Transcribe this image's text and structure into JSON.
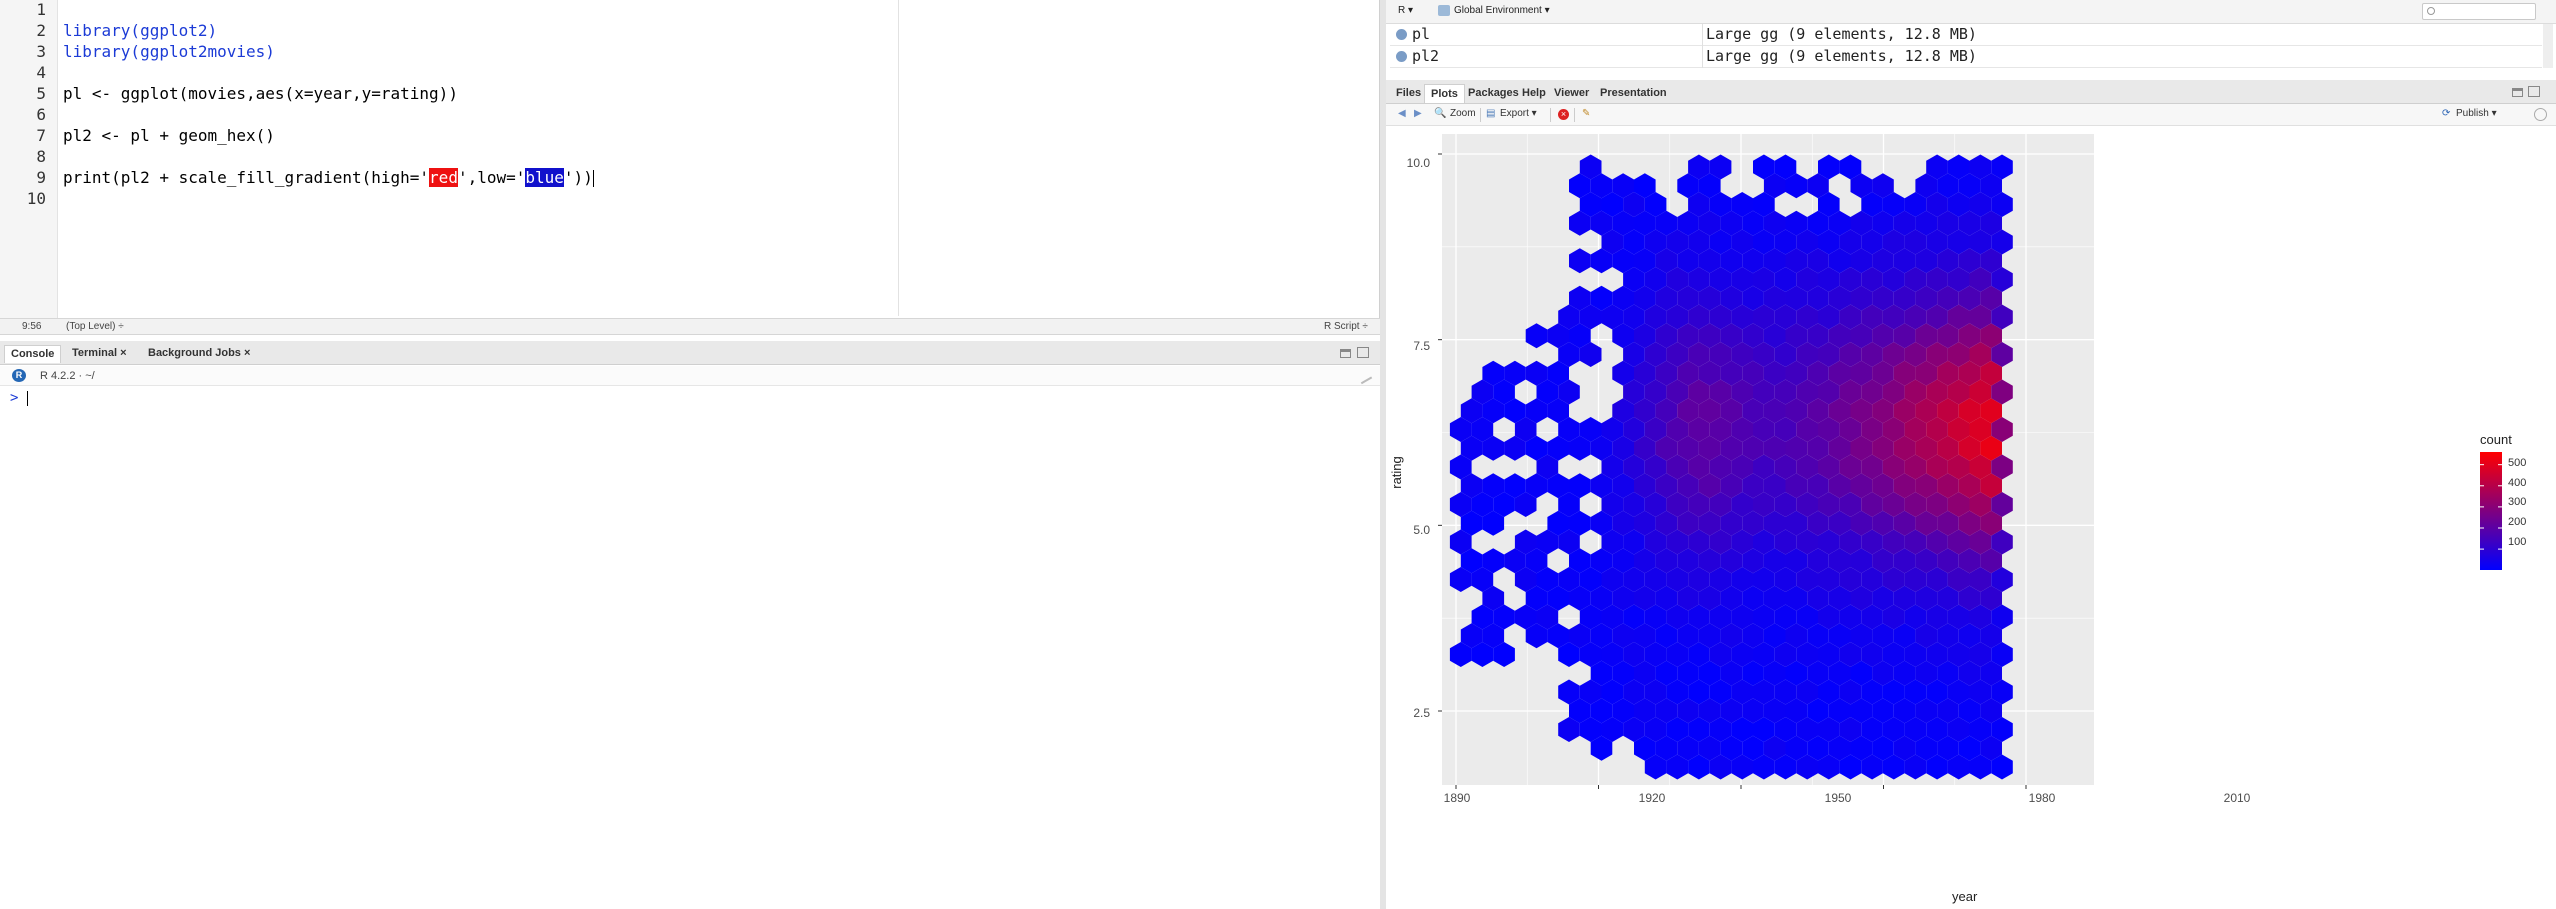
{
  "editor": {
    "lines": [
      {
        "num": "1",
        "html": ""
      },
      {
        "num": "2",
        "text_parts": [
          "library",
          "(ggplot2)"
        ]
      },
      {
        "num": "3",
        "text_parts": [
          "library",
          "(ggplot2movies)"
        ]
      },
      {
        "num": "4"
      },
      {
        "num": "5",
        "text": "pl <- ggplot(movies,aes(x=year,y=rating))"
      },
      {
        "num": "6"
      },
      {
        "num": "7",
        "text": "pl2 <- pl + geom_hex()"
      },
      {
        "num": "8"
      },
      {
        "num": "9"
      },
      {
        "num": "10"
      }
    ],
    "line2": "library(ggplot2)",
    "line3": "library(ggplot2movies)",
    "line5": "pl <- ggplot(movies,aes(x=year,y=rating))",
    "line7": "pl2 <- pl + geom_hex()",
    "line9_pre": "print(pl2 + scale_fill_gradient(high='",
    "line9_red": "red",
    "line9_mid": "',low='",
    "line9_blue": "blue",
    "line9_post": "'))",
    "status_pos": "9:56",
    "status_scope": "(Top Level) ÷",
    "status_type": "R Script ÷"
  },
  "console": {
    "tabs": [
      "Console",
      "Terminal ×",
      "Background Jobs ×"
    ],
    "r_version": "R 4.2.2 · ~/",
    "prompt": ">"
  },
  "environment": {
    "lang": "R ▾",
    "env_name": "Global Environment ▾",
    "rows": [
      {
        "name": "pl",
        "value": "Large gg (9 elements,  12.8 MB)"
      },
      {
        "name": "pl2",
        "value": "Large gg (9 elements,  12.8 MB)"
      }
    ]
  },
  "plots_pane": {
    "tabs": [
      "Files",
      "Plots",
      "Packages",
      "Help",
      "Viewer",
      "Presentation"
    ],
    "zoom": "Zoom",
    "export": "Export ▾",
    "publish": "Publish ▾"
  },
  "chart_data": {
    "type": "heatmap",
    "subtype": "hexbin",
    "xlabel": "year",
    "ylabel": "rating",
    "x_ticks": [
      "1890",
      "1920",
      "1950",
      "1980",
      "2010"
    ],
    "y_ticks": [
      "2.5",
      "5.0",
      "7.5",
      "10.0"
    ],
    "xlim": [
      1891,
      2006
    ],
    "ylim": [
      1,
      10
    ],
    "legend_title": "count",
    "legend_ticks": [
      "500",
      "400",
      "300",
      "200",
      "100"
    ],
    "legend_range": [
      1,
      560
    ],
    "low_color": "#0000ff",
    "high_color": "#ff0000",
    "grid": true,
    "legend_position": "right",
    "panel_background": "#ebebeb"
  }
}
